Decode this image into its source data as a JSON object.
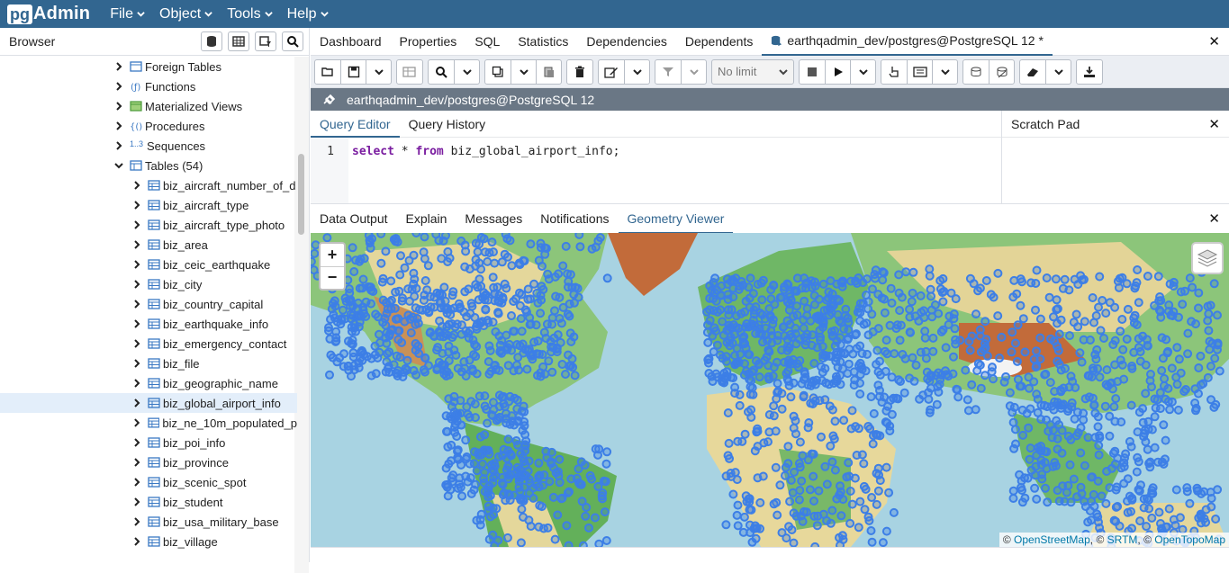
{
  "app": {
    "logo_pg": "pg",
    "logo_admin": "Admin"
  },
  "menu": [
    {
      "label": "File"
    },
    {
      "label": "Object"
    },
    {
      "label": "Tools"
    },
    {
      "label": "Help"
    }
  ],
  "browser": {
    "title": "Browser",
    "tree": [
      {
        "label": "Foreign Tables",
        "icon": "foreign-table-icon",
        "level": 1,
        "expanded": false
      },
      {
        "label": "Functions",
        "icon": "function-icon",
        "level": 1,
        "expanded": false
      },
      {
        "label": "Materialized Views",
        "icon": "mview-icon",
        "level": 1,
        "expanded": false
      },
      {
        "label": "Procedures",
        "icon": "procedure-icon",
        "level": 1,
        "expanded": false
      },
      {
        "label": "Sequences",
        "icon": "sequence-icon",
        "icon_text": "1..3",
        "level": 1,
        "expanded": false
      },
      {
        "label": "Tables (54)",
        "icon": "tables-icon",
        "level": 1,
        "expanded": true
      },
      {
        "label": "biz_aircraft_number_of_d",
        "icon": "table-icon",
        "level": 2
      },
      {
        "label": "biz_aircraft_type",
        "icon": "table-icon",
        "level": 2
      },
      {
        "label": "biz_aircraft_type_photo",
        "icon": "table-icon",
        "level": 2
      },
      {
        "label": "biz_area",
        "icon": "table-icon",
        "level": 2
      },
      {
        "label": "biz_ceic_earthquake",
        "icon": "table-icon",
        "level": 2
      },
      {
        "label": "biz_city",
        "icon": "table-icon",
        "level": 2
      },
      {
        "label": "biz_country_capital",
        "icon": "table-icon",
        "level": 2
      },
      {
        "label": "biz_earthquake_info",
        "icon": "table-icon",
        "level": 2
      },
      {
        "label": "biz_emergency_contact",
        "icon": "table-icon",
        "level": 2
      },
      {
        "label": "biz_file",
        "icon": "table-icon",
        "level": 2
      },
      {
        "label": "biz_geographic_name",
        "icon": "table-icon",
        "level": 2
      },
      {
        "label": "biz_global_airport_info",
        "icon": "table-icon",
        "level": 2,
        "selected": true
      },
      {
        "label": "biz_ne_10m_populated_p",
        "icon": "table-icon",
        "level": 2
      },
      {
        "label": "biz_poi_info",
        "icon": "table-icon",
        "level": 2
      },
      {
        "label": "biz_province",
        "icon": "table-icon",
        "level": 2
      },
      {
        "label": "biz_scenic_spot",
        "icon": "table-icon",
        "level": 2
      },
      {
        "label": "biz_student",
        "icon": "table-icon",
        "level": 2
      },
      {
        "label": "biz_usa_military_base",
        "icon": "table-icon",
        "level": 2
      },
      {
        "label": "biz_village",
        "icon": "table-icon",
        "level": 2
      }
    ]
  },
  "main_tabs": [
    {
      "label": "Dashboard"
    },
    {
      "label": "Properties"
    },
    {
      "label": "SQL"
    },
    {
      "label": "Statistics"
    },
    {
      "label": "Dependencies"
    },
    {
      "label": "Dependents"
    },
    {
      "label": "earthqadmin_dev/postgres@PostgreSQL 12 *",
      "active": true
    }
  ],
  "toolbar": {
    "limit_label": "No limit"
  },
  "connection": {
    "label": "earthqadmin_dev/postgres@PostgreSQL 12"
  },
  "editor": {
    "tabs": [
      {
        "label": "Query Editor",
        "active": true
      },
      {
        "label": "Query History"
      }
    ],
    "line_number": "1",
    "sql": {
      "kw1": "select",
      "mid": " * ",
      "kw2": "from",
      "rest": " biz_global_airport_info;"
    },
    "scratch_title": "Scratch Pad"
  },
  "output_tabs": [
    {
      "label": "Data Output"
    },
    {
      "label": "Explain"
    },
    {
      "label": "Messages"
    },
    {
      "label": "Notifications"
    },
    {
      "label": "Geometry Viewer",
      "active": true
    }
  ],
  "map": {
    "zoom_in": "+",
    "zoom_out": "−",
    "attribution_prefix": "©",
    "attribution": [
      "OpenStreetMap",
      "SRTM",
      "OpenTopoMap"
    ],
    "colors": {
      "water": "#a8d3e2",
      "points": "#3d7fe6",
      "land_green": "#7fbf6a",
      "land_yellow": "#e8dca0",
      "land_brown": "#c7854a"
    }
  },
  "colors": {
    "navbar": "#326690",
    "connection_bar": "#6a7785",
    "accent": "#326690"
  }
}
